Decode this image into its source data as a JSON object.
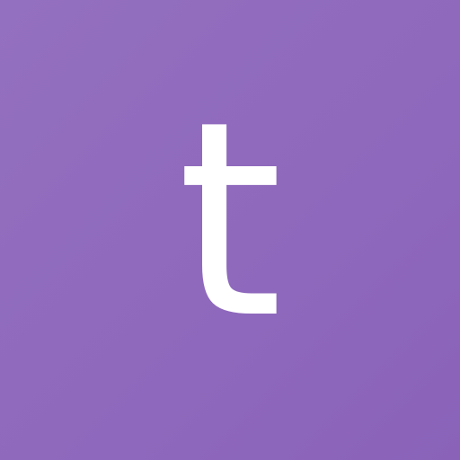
{
  "avatar": {
    "initial": "t",
    "background_color": "#8f69bd",
    "text_color": "#ffffff"
  }
}
